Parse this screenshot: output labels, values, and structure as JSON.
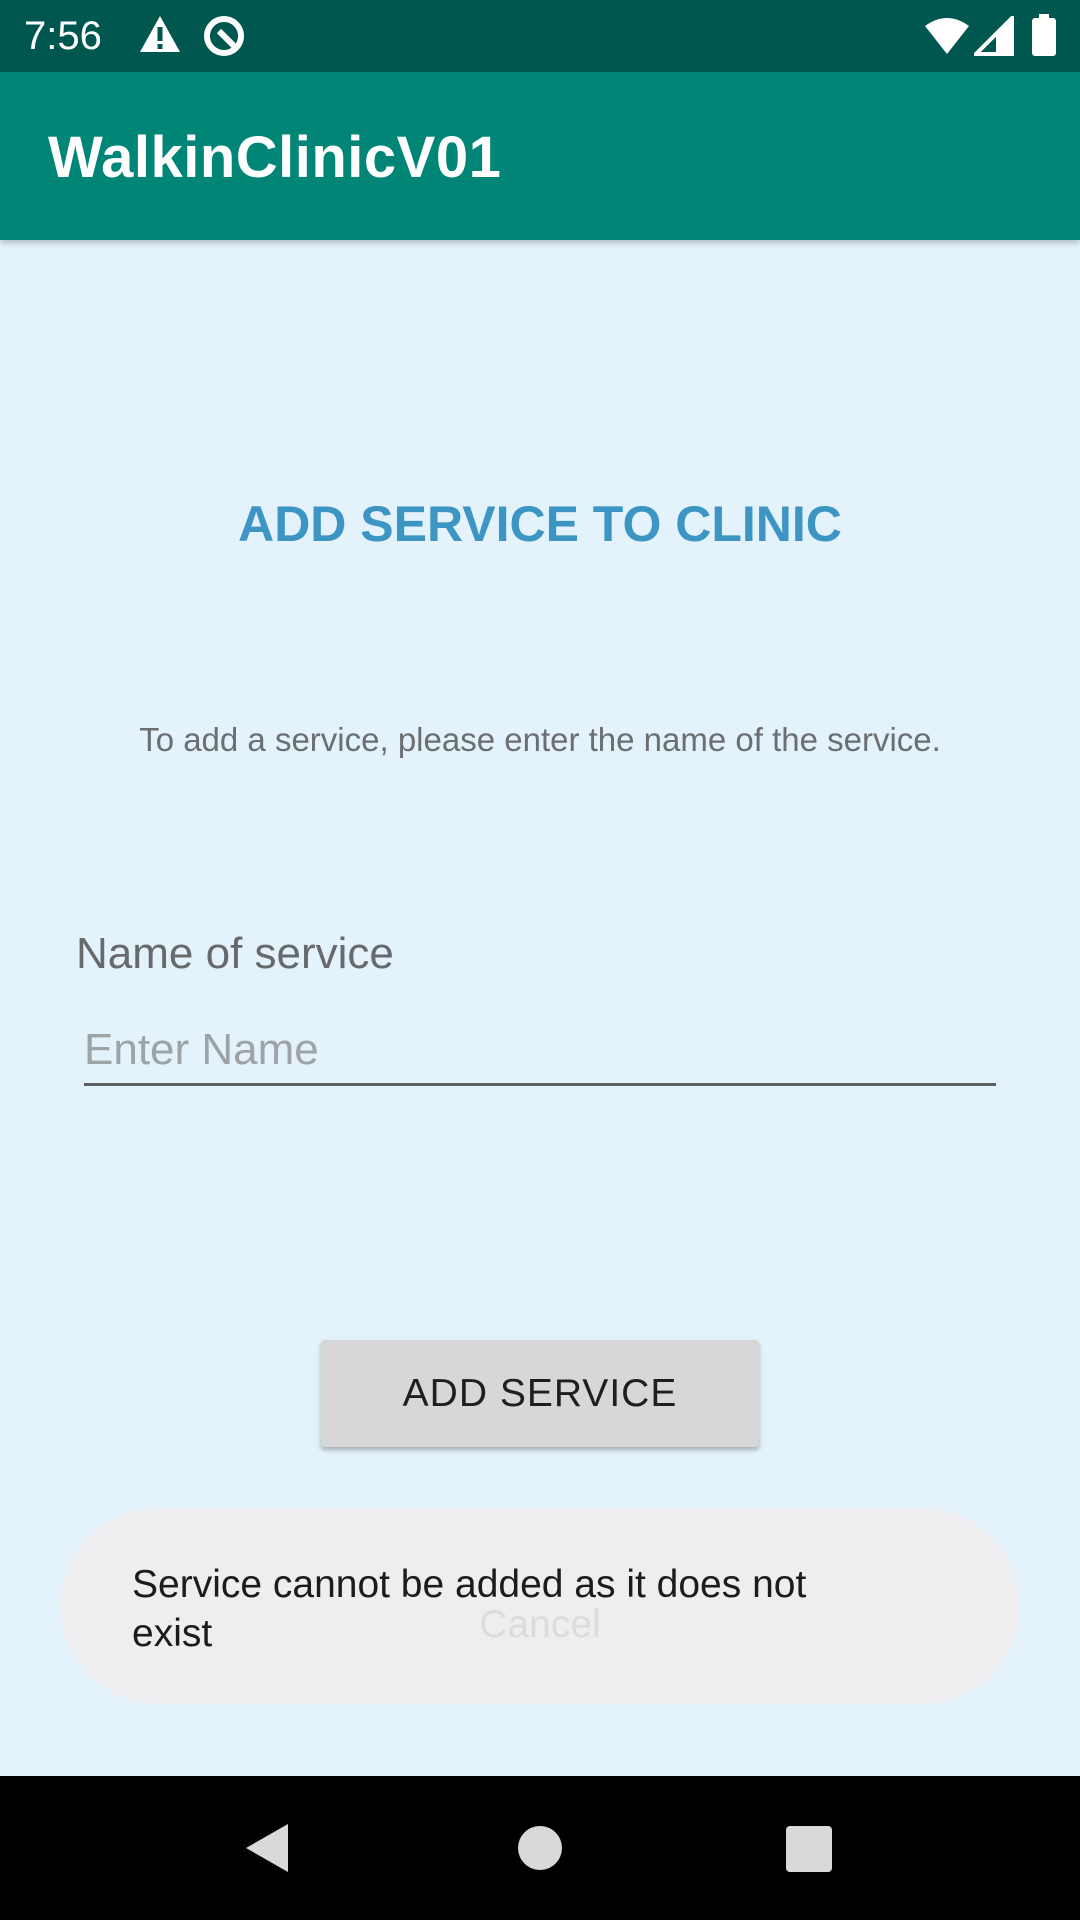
{
  "status_bar": {
    "time": "7:56",
    "icons": [
      "warning-icon",
      "data-saver-icon",
      "wifi-icon",
      "signal-icon",
      "battery-icon"
    ]
  },
  "app_bar": {
    "title": "WalkinClinicV01",
    "color": "#008577"
  },
  "main": {
    "heading": "ADD SERVICE TO CLINIC",
    "instruction": "To add a service, please enter the name of the service.",
    "field_label": "Name of service",
    "name_input": {
      "value": "",
      "placeholder": "Enter Name"
    },
    "add_button_label": "ADD SERVICE"
  },
  "toast": {
    "message": "Service cannot be added as it does not exist",
    "cancel_label": "Cancel"
  },
  "nav_bar": {
    "icons": [
      "back-icon",
      "home-icon",
      "recents-icon"
    ]
  },
  "colors": {
    "background": "#e3f2fb",
    "status_bar": "#00574f",
    "heading": "#3c95c2"
  }
}
